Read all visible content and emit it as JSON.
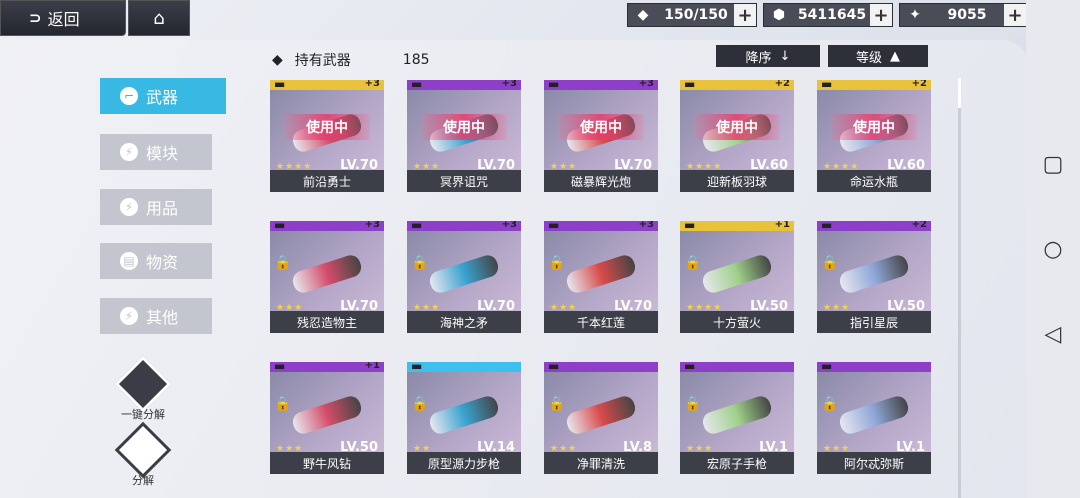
{
  "topbar": {
    "back_label": "返回",
    "back_icon": "back-arrow-icon",
    "home_icon": "home-icon"
  },
  "resources": [
    {
      "icon": "stamina-icon",
      "value": "150/150",
      "plus": "+"
    },
    {
      "icon": "purple-crystal-icon",
      "value": "5411645",
      "plus": "+"
    },
    {
      "icon": "diamond-icon",
      "value": "9055",
      "plus": "+"
    }
  ],
  "header": {
    "title": "持有武器",
    "count": "185",
    "sort_order_label": "降序",
    "sort_key_label": "等级"
  },
  "categories": [
    {
      "label": "武器",
      "active": true
    },
    {
      "label": "模块",
      "active": false
    },
    {
      "label": "用品",
      "active": false
    },
    {
      "label": "物资",
      "active": false
    },
    {
      "label": "其他",
      "active": false
    }
  ],
  "actions": {
    "one_click_label": "一键分解",
    "decompose_label": "分解"
  },
  "in_use_label": "使用中",
  "weapons": [
    {
      "name": "前沿勇士",
      "level": "LV.70",
      "stars": 4,
      "plus": "+3",
      "rarity": "gold",
      "in_use": true
    },
    {
      "name": "冥界诅咒",
      "level": "LV.70",
      "stars": 3,
      "plus": "+3",
      "rarity": "purple",
      "in_use": true
    },
    {
      "name": "磁暴辉光炮",
      "level": "LV.70",
      "stars": 3,
      "plus": "+3",
      "rarity": "purple",
      "in_use": true
    },
    {
      "name": "迎新板羽球",
      "level": "LV.60",
      "stars": 4,
      "plus": "+2",
      "rarity": "gold",
      "in_use": true
    },
    {
      "name": "命运水瓶",
      "level": "LV.60",
      "stars": 4,
      "plus": "+2",
      "rarity": "gold",
      "in_use": true
    },
    {
      "name": "残忍造物主",
      "level": "LV.70",
      "stars": 3,
      "plus": "+3",
      "rarity": "purple",
      "in_use": false
    },
    {
      "name": "海神之矛",
      "level": "LV.70",
      "stars": 3,
      "plus": "+3",
      "rarity": "purple",
      "in_use": false
    },
    {
      "name": "千本红莲",
      "level": "LV.70",
      "stars": 3,
      "plus": "+3",
      "rarity": "purple",
      "in_use": false
    },
    {
      "name": "十方萤火",
      "level": "LV.50",
      "stars": 4,
      "plus": "+1",
      "rarity": "gold",
      "in_use": false
    },
    {
      "name": "指引星辰",
      "level": "LV.50",
      "stars": 3,
      "plus": "+2",
      "rarity": "purple",
      "in_use": false
    },
    {
      "name": "野牛风钻",
      "level": "LV.50",
      "stars": 3,
      "plus": "+1",
      "rarity": "purple",
      "in_use": false
    },
    {
      "name": "原型源力步枪",
      "level": "LV.14",
      "stars": 2,
      "plus": "",
      "rarity": "blue",
      "in_use": false
    },
    {
      "name": "净罪清洗",
      "level": "LV.8",
      "stars": 3,
      "plus": "",
      "rarity": "purple",
      "in_use": false
    },
    {
      "name": "宏原子手枪",
      "level": "LV.1",
      "stars": 3,
      "plus": "",
      "rarity": "purple",
      "in_use": false
    },
    {
      "name": "阿尔忒弥斯",
      "level": "LV.1",
      "stars": 3,
      "plus": "",
      "rarity": "purple",
      "in_use": false
    }
  ],
  "colors": {
    "gold": "#e8c23a",
    "purple": "#8e3fc8",
    "blue": "#3ec0ee",
    "accent": "#38b9e4"
  }
}
